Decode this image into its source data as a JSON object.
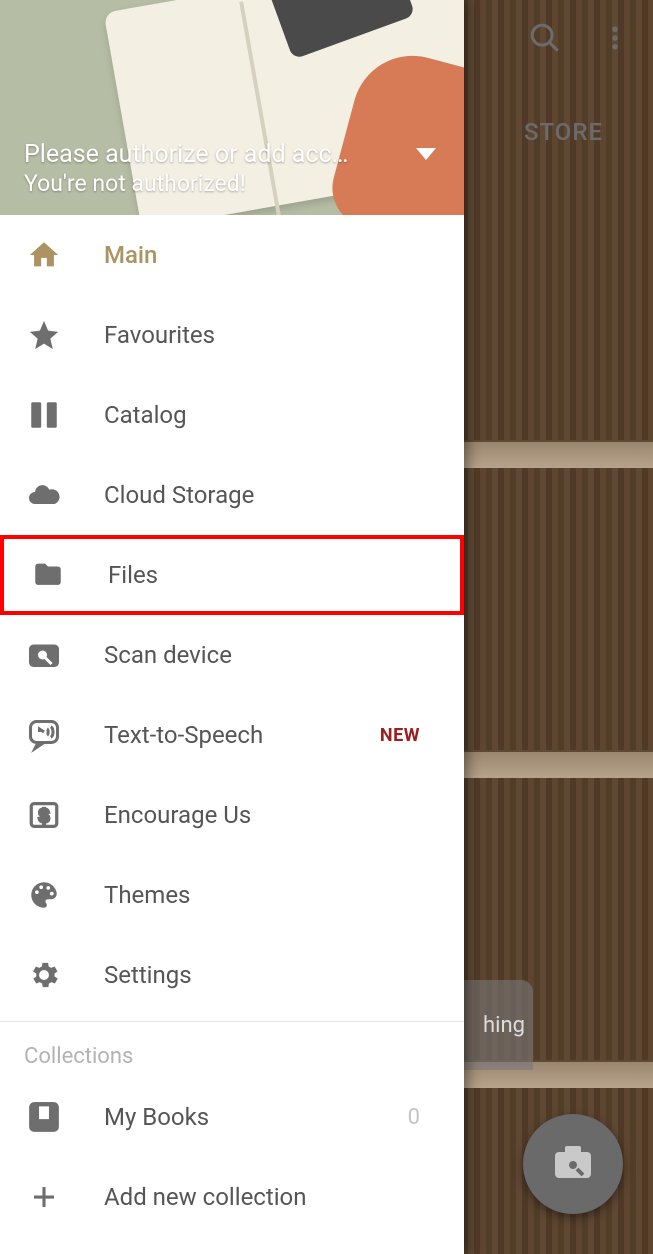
{
  "background": {
    "store_tab": "STORE",
    "bubble_text": "hing"
  },
  "header": {
    "title": "Please authorize or add acco…",
    "subtitle": "You're not authorized!"
  },
  "menu": {
    "main": "Main",
    "favourites": "Favourites",
    "catalog": "Catalog",
    "cloud": "Cloud Storage",
    "files": "Files",
    "scan": "Scan device",
    "tts": "Text-to-Speech",
    "tts_badge": "NEW",
    "encourage": "Encourage Us",
    "themes": "Themes",
    "settings": "Settings"
  },
  "collections": {
    "section_title": "Collections",
    "my_books": "My Books",
    "my_books_count": "0",
    "add_new": "Add new collection"
  }
}
